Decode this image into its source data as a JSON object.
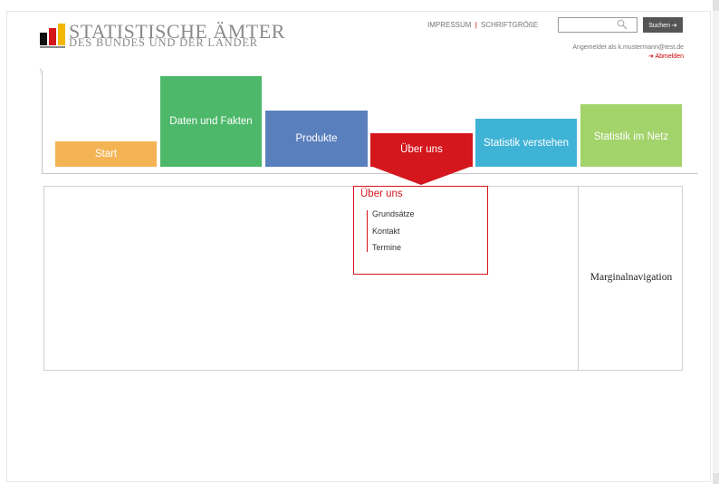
{
  "header": {
    "logo_title": "STATISTISCHE ÄMTER",
    "logo_subtitle": "DES BUNDES UND DER LÄNDER",
    "links": {
      "impressum": "IMPRESSUM",
      "separator": "|",
      "schriftgroesse": "SCHRIFTGRÖßE"
    },
    "search": {
      "placeholder": "",
      "button_label": "Suchen ➔"
    },
    "login_info": "Angemeldet als k.mustermann@test.de",
    "logout_label": "➔ Abmelden"
  },
  "nav": {
    "items": [
      {
        "label": "Start",
        "color": "#f5b454"
      },
      {
        "label": "Daten und Fakten",
        "color": "#4db86a"
      },
      {
        "label": "Produkte",
        "color": "#5a7fbd"
      },
      {
        "label": "Über uns",
        "color": "#d4161d",
        "active": true
      },
      {
        "label": "Statistik verstehen",
        "color": "#3fb3d6"
      },
      {
        "label": "Statistik im Netz",
        "color": "#a3d36b"
      }
    ]
  },
  "submenu": {
    "title": "Über uns",
    "items": [
      "Grundsätze",
      "Kontakt",
      "Termine"
    ]
  },
  "sidebar": {
    "label": "Marginalnavigation"
  },
  "colors": {
    "accent": "#d4161d",
    "text_gray": "#8a8a8a"
  }
}
